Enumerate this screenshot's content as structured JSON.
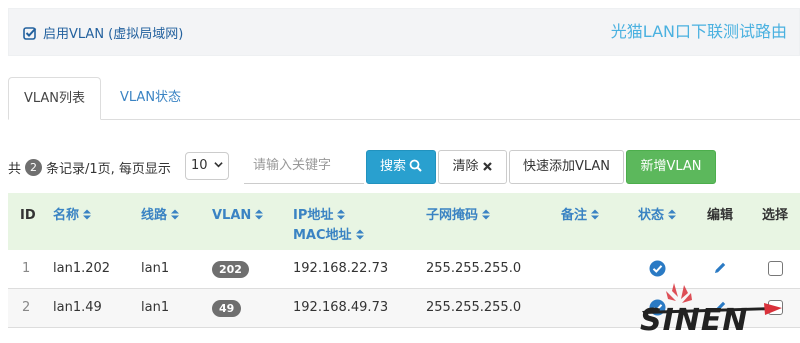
{
  "header": {
    "enable_label": "启用VLAN (虚拟局域网)",
    "title": "光猫LAN口下联测试路由"
  },
  "tabs": [
    {
      "label": "VLAN列表"
    },
    {
      "label": "VLAN状态"
    }
  ],
  "toolbar": {
    "prefix": "共",
    "count": "2",
    "suffix": "条记录/1页, 每页显示",
    "page_size": "10",
    "search_placeholder": "请输入关键字",
    "search_label": "搜索",
    "clear_label": "清除",
    "quick_add_label": "快速添加VLAN",
    "new_label": "新增VLAN"
  },
  "table": {
    "headers": {
      "id": "ID",
      "name": "名称",
      "line": "线路",
      "vlan": "VLAN",
      "ip": "IP地址",
      "mac": "MAC地址",
      "mask": "子网掩码",
      "note": "备注",
      "status": "状态",
      "edit": "编辑",
      "select": "选择"
    },
    "rows": [
      {
        "id": "1",
        "name": "lan1.202",
        "line": "lan1",
        "vlan": "202",
        "ip": "192.168.22.73",
        "mask": "255.255.255.0",
        "status": "enabled",
        "selected": false
      },
      {
        "id": "2",
        "name": "lan1.49",
        "line": "lan1",
        "vlan": "49",
        "ip": "192.168.49.73",
        "mask": "255.255.255.0",
        "status": "enabled",
        "selected": false
      }
    ]
  },
  "watermark": {
    "text": "SINEN"
  },
  "colors": {
    "link_blue": "#3a83c3",
    "title_blue": "#4ab1e0",
    "search_button": "#29a0cf",
    "new_button": "#5cb85c",
    "header_row": "#e8f5e3",
    "badge": "#6f6f6f",
    "status_blue": "#2a7ac4"
  },
  "icons": {
    "enable_checkbox": "checked-box-icon",
    "search": "magnifier-icon",
    "clear": "x-icon",
    "sort": "sort-arrows-icon",
    "status": "check-circle-icon",
    "edit": "pencil-icon"
  }
}
